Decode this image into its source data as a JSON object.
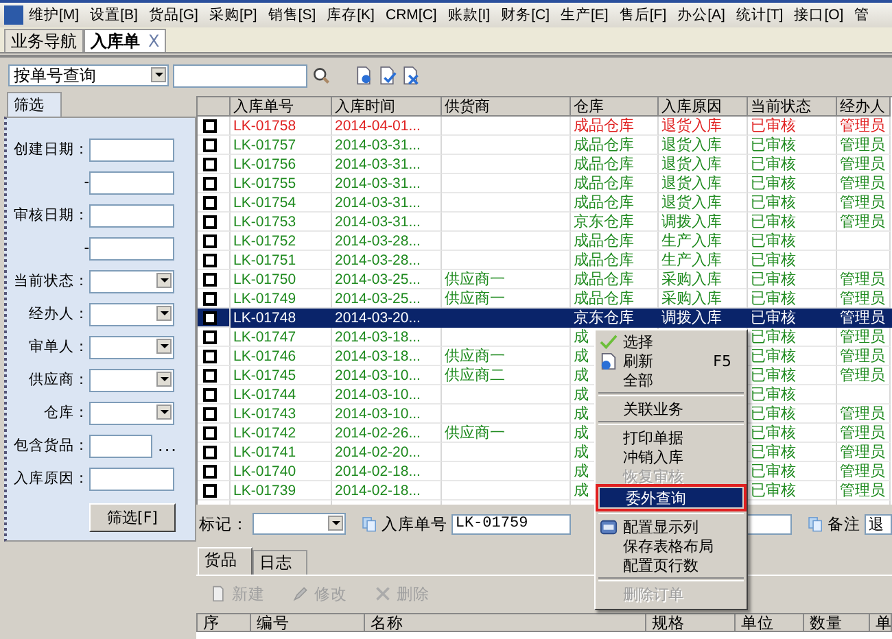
{
  "menu_bar": {
    "items": [
      "维护[M]",
      "设置[B]",
      "货品[G]",
      "采购[P]",
      "销售[S]",
      "库存[K]",
      "CRM[C]",
      "账款[I]",
      "财务[C]",
      "生产[E]",
      "售后[F]",
      "办公[A]",
      "统计[T]",
      "接口[O]",
      "管"
    ]
  },
  "tabs": [
    {
      "label": "业务导航",
      "selected": false
    },
    {
      "label": "入库单",
      "selected": true,
      "close": "X"
    }
  ],
  "toolbar": {
    "query_mode": "按单号查询"
  },
  "filter_panel": {
    "tab": "筛选",
    "fields": [
      {
        "label": "创建日期：",
        "kind": "text"
      },
      {
        "label": "-",
        "kind": "text"
      },
      {
        "label": "审核日期：",
        "kind": "text"
      },
      {
        "label": "-",
        "kind": "text"
      },
      {
        "label": "当前状态：",
        "kind": "combo"
      },
      {
        "label": "经办人：",
        "kind": "combo"
      },
      {
        "label": "审单人：",
        "kind": "combo"
      },
      {
        "label": "供应商：",
        "kind": "combo"
      },
      {
        "label": "仓库：",
        "kind": "combo"
      },
      {
        "label": "包含货品：",
        "kind": "more",
        "more": "..."
      },
      {
        "label": "入库原因：",
        "kind": "text"
      }
    ],
    "button": "筛选[F]"
  },
  "table": {
    "columns": [
      "入库单号",
      "入库时间",
      "供货商",
      "仓库",
      "入库原因",
      "当前状态",
      "经办人"
    ],
    "rows": [
      {
        "checked": false,
        "selected": false,
        "color": "#e02020",
        "cells": [
          "LK-01758",
          "2014-04-01...",
          "",
          "成品仓库",
          "退货入库",
          "已审核",
          "管理员"
        ]
      },
      {
        "checked": false,
        "selected": false,
        "color": "#1e8a1e",
        "cells": [
          "LK-01757",
          "2014-03-31...",
          "",
          "成品仓库",
          "退货入库",
          "已审核",
          "管理员"
        ]
      },
      {
        "checked": false,
        "selected": false,
        "color": "#1e8a1e",
        "cells": [
          "LK-01756",
          "2014-03-31...",
          "",
          "成品仓库",
          "退货入库",
          "已审核",
          "管理员"
        ]
      },
      {
        "checked": false,
        "selected": false,
        "color": "#1e8a1e",
        "cells": [
          "LK-01755",
          "2014-03-31...",
          "",
          "成品仓库",
          "退货入库",
          "已审核",
          "管理员"
        ]
      },
      {
        "checked": false,
        "selected": false,
        "color": "#1e8a1e",
        "cells": [
          "LK-01754",
          "2014-03-31...",
          "",
          "成品仓库",
          "退货入库",
          "已审核",
          "管理员"
        ]
      },
      {
        "checked": false,
        "selected": false,
        "color": "#1e8a1e",
        "cells": [
          "LK-01753",
          "2014-03-31...",
          "",
          "京东仓库",
          "调拨入库",
          "已审核",
          "管理员"
        ]
      },
      {
        "checked": false,
        "selected": false,
        "color": "#1e8a1e",
        "cells": [
          "LK-01752",
          "2014-03-28...",
          "",
          "成品仓库",
          "生产入库",
          "已审核",
          ""
        ]
      },
      {
        "checked": false,
        "selected": false,
        "color": "#1e8a1e",
        "cells": [
          "LK-01751",
          "2014-03-28...",
          "",
          "成品仓库",
          "生产入库",
          "已审核",
          ""
        ]
      },
      {
        "checked": false,
        "selected": false,
        "color": "#1e8a1e",
        "cells": [
          "LK-01750",
          "2014-03-25...",
          "供应商一",
          "成品仓库",
          "采购入库",
          "已审核",
          "管理员"
        ]
      },
      {
        "checked": false,
        "selected": false,
        "color": "#1e8a1e",
        "cells": [
          "LK-01749",
          "2014-03-25...",
          "供应商一",
          "成品仓库",
          "采购入库",
          "已审核",
          "管理员"
        ]
      },
      {
        "checked": false,
        "selected": true,
        "cells": [
          "LK-01748",
          "2014-03-20...",
          "",
          "京东仓库",
          "调拨入库",
          "已审核",
          "管理员"
        ]
      },
      {
        "checked": false,
        "selected": false,
        "color": "#1e8a1e",
        "cells": [
          "LK-01747",
          "2014-03-18...",
          "",
          "成",
          "",
          "已审核",
          "管理员"
        ]
      },
      {
        "checked": false,
        "selected": false,
        "color": "#1e8a1e",
        "cells": [
          "LK-01746",
          "2014-03-18...",
          "供应商一",
          "成",
          "",
          "已审核",
          "管理员"
        ]
      },
      {
        "checked": false,
        "selected": false,
        "color": "#1e8a1e",
        "cells": [
          "LK-01745",
          "2014-03-10...",
          "供应商二",
          "成",
          "",
          "已审核",
          "管理员"
        ]
      },
      {
        "checked": false,
        "selected": false,
        "color": "#1e8a1e",
        "cells": [
          "LK-01744",
          "2014-03-10...",
          "",
          "成",
          "",
          "已审核",
          ""
        ]
      },
      {
        "checked": false,
        "selected": false,
        "color": "#1e8a1e",
        "cells": [
          "LK-01743",
          "2014-03-10...",
          "",
          "成",
          "",
          "已审核",
          "管理员"
        ]
      },
      {
        "checked": false,
        "selected": false,
        "color": "#1e8a1e",
        "cells": [
          "LK-01742",
          "2014-02-26...",
          "供应商一",
          "成",
          "",
          "已审核",
          "管理员"
        ]
      },
      {
        "checked": false,
        "selected": false,
        "color": "#1e8a1e",
        "cells": [
          "LK-01741",
          "2014-02-20...",
          "",
          "成",
          "",
          "已审核",
          "管理员"
        ]
      },
      {
        "checked": false,
        "selected": false,
        "color": "#1e8a1e",
        "cells": [
          "LK-01740",
          "2014-02-18...",
          "",
          "成",
          "",
          "已审核",
          "管理员"
        ]
      },
      {
        "checked": false,
        "selected": false,
        "color": "#1e8a1e",
        "cells": [
          "LK-01739",
          "2014-02-18...",
          "",
          "成",
          "",
          "已审核",
          "管理员"
        ]
      }
    ]
  },
  "context_menu": {
    "items": [
      {
        "kind": "item",
        "label": "选择",
        "disabled": false,
        "selected": false
      },
      {
        "kind": "item",
        "label": "刷新",
        "shortcut": "F5",
        "disabled": false,
        "selected": false
      },
      {
        "kind": "item",
        "label": "全部",
        "disabled": false,
        "selected": false
      },
      {
        "kind": "separator"
      },
      {
        "kind": "item",
        "label": "关联业务",
        "disabled": false,
        "selected": false
      },
      {
        "kind": "separator"
      },
      {
        "kind": "item",
        "label": "打印单据",
        "disabled": false,
        "selected": false
      },
      {
        "kind": "item",
        "label": "冲销入库",
        "disabled": false,
        "selected": false
      },
      {
        "kind": "item",
        "label": "恢复审核",
        "disabled": true,
        "selected": false
      },
      {
        "kind": "item",
        "label": "委外查询",
        "disabled": false,
        "selected": true
      },
      {
        "kind": "separator"
      },
      {
        "kind": "item",
        "label": "配置显示列",
        "disabled": false,
        "selected": false
      },
      {
        "kind": "item",
        "label": "保存表格布局",
        "disabled": false,
        "selected": false
      },
      {
        "kind": "item",
        "label": "配置页行数",
        "disabled": false,
        "selected": false
      },
      {
        "kind": "separator"
      },
      {
        "kind": "item",
        "label": "删除订单",
        "disabled": true,
        "selected": false
      }
    ]
  },
  "mark_bar": {
    "mark_label": "标记：",
    "order_label": "入库单号",
    "order_value": "LK-01759",
    "note_label": "备注",
    "note_value": "退"
  },
  "detail_tabs": [
    {
      "label": "货品",
      "selected": true
    },
    {
      "label": "日志",
      "selected": false
    }
  ],
  "detail_toolbar": [
    {
      "label": "新建",
      "disabled": true
    },
    {
      "label": "修改",
      "disabled": true
    },
    {
      "label": "删除",
      "disabled": true
    }
  ],
  "detail_table": {
    "columns": [
      "序",
      "编号",
      "名称",
      "规格",
      "单位",
      "数量",
      "单"
    ]
  }
}
